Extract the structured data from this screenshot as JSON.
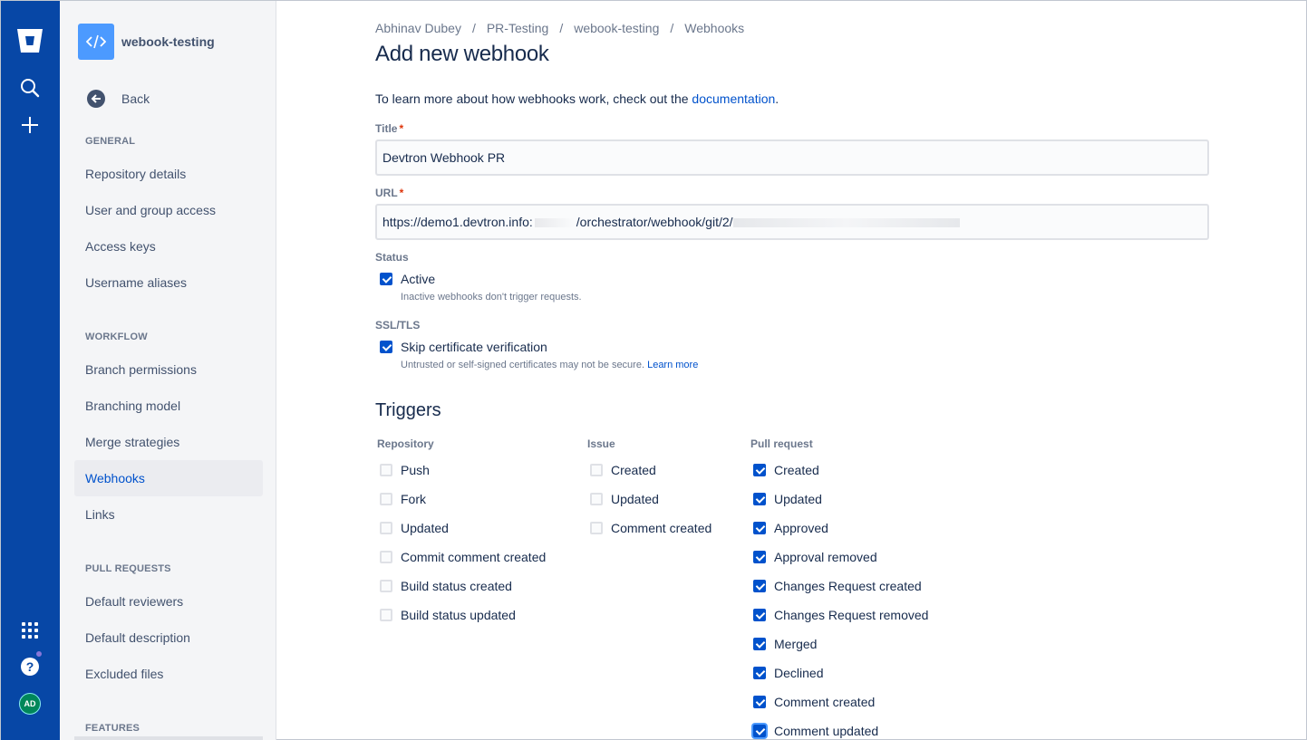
{
  "rail": {
    "icons": [
      "bitbucket-logo-icon",
      "search-icon",
      "create-icon",
      "apps-icon",
      "help-icon"
    ],
    "avatar_initials": "AD"
  },
  "sidebar": {
    "repo_name": "webook-testing",
    "back_label": "Back",
    "sections": [
      {
        "title": "GENERAL",
        "items": [
          "Repository details",
          "User and group access",
          "Access keys",
          "Username aliases"
        ]
      },
      {
        "title": "WORKFLOW",
        "items": [
          "Branch permissions",
          "Branching model",
          "Merge strategies",
          "Webhooks",
          "Links"
        ]
      },
      {
        "title": "PULL REQUESTS",
        "items": [
          "Default reviewers",
          "Default description",
          "Excluded files"
        ]
      },
      {
        "title": "FEATURES",
        "items": []
      }
    ],
    "active_item": "Webhooks"
  },
  "breadcrumbs": [
    "Abhinav Dubey",
    "PR-Testing",
    "webook-testing",
    "Webhooks"
  ],
  "page_title": "Add new webhook",
  "intro": {
    "text": "To learn more about how webhooks work, check out the ",
    "link": "documentation",
    "suffix": "."
  },
  "form": {
    "title_label": "Title",
    "title_value": "Devtron Webhook PR",
    "url_label": "URL",
    "url_value": "https://demo1.devtron.info:",
    "url_value_tail": "/orchestrator/webhook/git/2/",
    "status_label": "Status",
    "active_label": "Active",
    "active_checked": true,
    "active_helper": "Inactive webhooks don't trigger requests.",
    "ssl_label": "SSL/TLS",
    "skip_label": "Skip certificate verification",
    "skip_checked": true,
    "skip_helper": "Untrusted or self-signed certificates may not be secure.",
    "skip_helper_link": "Learn more"
  },
  "triggers": {
    "title": "Triggers",
    "columns": [
      {
        "title": "Repository",
        "items": [
          {
            "label": "Push",
            "checked": false
          },
          {
            "label": "Fork",
            "checked": false
          },
          {
            "label": "Updated",
            "checked": false
          },
          {
            "label": "Commit comment created",
            "checked": false
          },
          {
            "label": "Build status created",
            "checked": false
          },
          {
            "label": "Build status updated",
            "checked": false
          }
        ]
      },
      {
        "title": "Issue",
        "items": [
          {
            "label": "Created",
            "checked": false
          },
          {
            "label": "Updated",
            "checked": false
          },
          {
            "label": "Comment created",
            "checked": false
          }
        ]
      },
      {
        "title": "Pull request",
        "items": [
          {
            "label": "Created",
            "checked": true
          },
          {
            "label": "Updated",
            "checked": true
          },
          {
            "label": "Approved",
            "checked": true
          },
          {
            "label": "Approval removed",
            "checked": true
          },
          {
            "label": "Changes Request created",
            "checked": true
          },
          {
            "label": "Changes Request removed",
            "checked": true
          },
          {
            "label": "Merged",
            "checked": true
          },
          {
            "label": "Declined",
            "checked": true
          },
          {
            "label": "Comment created",
            "checked": true
          },
          {
            "label": "Comment updated",
            "checked": true
          }
        ]
      }
    ]
  },
  "colors": {
    "rail": "#0747A6",
    "accent": "#0052CC",
    "sidebar_bg": "#F4F5F7"
  }
}
